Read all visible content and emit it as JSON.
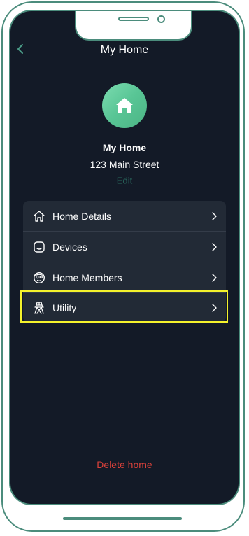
{
  "header": {
    "title": "My Home",
    "back_icon": "chevron-left-icon"
  },
  "home": {
    "avatar_icon": "house-icon",
    "name": "My Home",
    "address": "123 Main Street",
    "edit_label": "Edit"
  },
  "menu": {
    "items": [
      {
        "label": "Home Details",
        "icon": "house-outline-icon"
      },
      {
        "label": "Devices",
        "icon": "device-icon"
      },
      {
        "label": "Home Members",
        "icon": "members-icon"
      },
      {
        "label": "Utility",
        "icon": "power-tower-icon"
      }
    ]
  },
  "actions": {
    "delete_label": "Delete home"
  },
  "colors": {
    "background": "#131a27",
    "card": "#222a36",
    "accent": "#4b8c7c",
    "avatar": "#58c595",
    "edit": "#2a6a5e",
    "danger": "#d9413a",
    "highlight": "#f4f22c"
  }
}
